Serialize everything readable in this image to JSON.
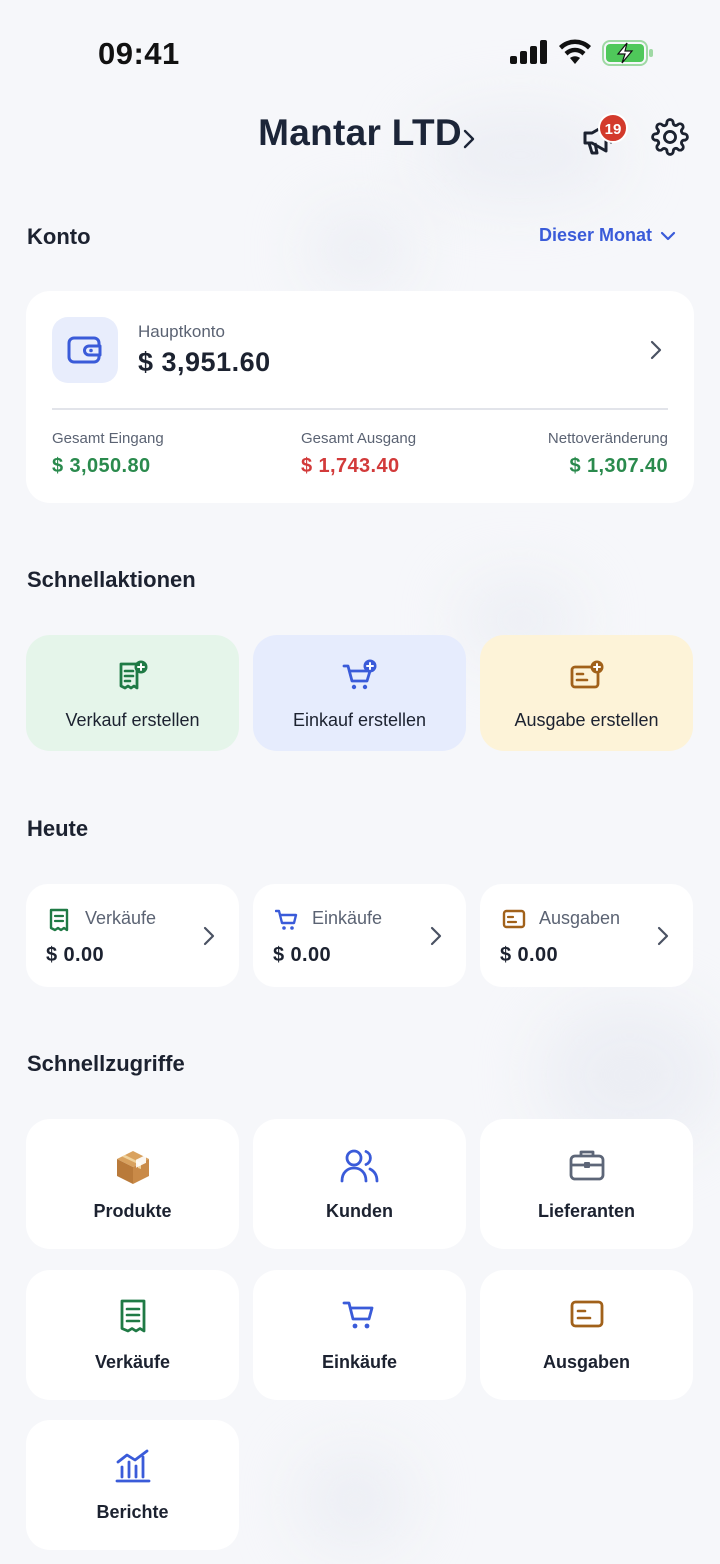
{
  "status_bar": {
    "time": "09:41"
  },
  "header": {
    "company": "Mantar LTD",
    "notification_count": "19"
  },
  "account": {
    "section_title": "Konto",
    "period": "Dieser Monat",
    "main_label": "Hauptkonto",
    "main_balance": "$ 3,951.60",
    "stats": [
      {
        "label": "Gesamt Eingang",
        "value": "$ 3,050.80",
        "color": "#2a8a4d"
      },
      {
        "label": "Gesamt Ausgang",
        "value": "$ 1,743.40",
        "color": "#d23a3a"
      },
      {
        "label": "Nettoveränderung",
        "value": "$ 1,307.40",
        "color": "#2a8a4d"
      }
    ]
  },
  "quick_actions": {
    "section_title": "Schnellaktionen",
    "items": [
      {
        "label": "Verkauf erstellen",
        "icon": "receipt-add-icon",
        "bg": "#e5f5ea",
        "color": "#1f7a45"
      },
      {
        "label": "Einkauf erstellen",
        "icon": "cart-add-icon",
        "bg": "#e6ecfd",
        "color": "#3a5bd9"
      },
      {
        "label": "Ausgabe erstellen",
        "icon": "wallet-add-icon",
        "bg": "#fdf3d8",
        "color": "#a1611a"
      }
    ]
  },
  "today": {
    "section_title": "Heute",
    "items": [
      {
        "label": "Verkäufe",
        "value": "$ 0.00",
        "icon": "receipt-icon"
      },
      {
        "label": "Einkäufe",
        "value": "$ 0.00",
        "icon": "cart-icon"
      },
      {
        "label": "Ausgaben",
        "value": "$ 0.00",
        "icon": "expense-card-icon"
      }
    ]
  },
  "shortcuts": {
    "section_title": "Schnellzugriffe",
    "items": [
      {
        "label": "Produkte",
        "icon": "package-icon"
      },
      {
        "label": "Kunden",
        "icon": "users-icon"
      },
      {
        "label": "Lieferanten",
        "icon": "briefcase-icon"
      },
      {
        "label": "Verkäufe",
        "icon": "receipt-icon"
      },
      {
        "label": "Einkäufe",
        "icon": "cart-icon"
      },
      {
        "label": "Ausgaben",
        "icon": "expense-card-icon"
      },
      {
        "label": "Berichte",
        "icon": "chart-icon"
      }
    ]
  }
}
